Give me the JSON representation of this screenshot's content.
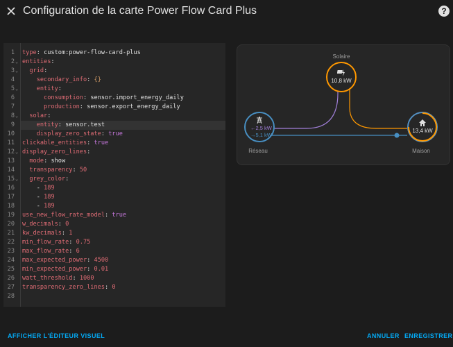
{
  "dialog": {
    "title": "Configuration de la carte Power Flow Card Plus",
    "close_icon": "close-icon",
    "help_icon": "help-circle-icon"
  },
  "editor": {
    "lines": [
      {
        "n": "1",
        "fold": false,
        "indent": "",
        "key": "type",
        "value": "custom:power-flow-card-plus",
        "vtype": "s"
      },
      {
        "n": "2",
        "fold": true,
        "indent": "",
        "key": "entities",
        "value": "",
        "vtype": ""
      },
      {
        "n": "3",
        "fold": true,
        "indent": "  ",
        "key": "grid",
        "value": "",
        "vtype": ""
      },
      {
        "n": "4",
        "fold": false,
        "indent": "    ",
        "key": "secondary_info",
        "value": "{}",
        "vtype": "o"
      },
      {
        "n": "5",
        "fold": true,
        "indent": "    ",
        "key": "entity",
        "value": "",
        "vtype": ""
      },
      {
        "n": "6",
        "fold": false,
        "indent": "      ",
        "key": "consumption",
        "value": "sensor.import_energy_daily",
        "vtype": "s"
      },
      {
        "n": "7",
        "fold": false,
        "indent": "      ",
        "key": "production",
        "value": "sensor.export_energy_daily",
        "vtype": "s"
      },
      {
        "n": "8",
        "fold": true,
        "indent": "  ",
        "key": "solar",
        "value": "",
        "vtype": ""
      },
      {
        "n": "9",
        "fold": false,
        "indent": "    ",
        "key": "entity",
        "value": "sensor.test",
        "vtype": "s"
      },
      {
        "n": "10",
        "fold": false,
        "indent": "    ",
        "key": "display_zero_state",
        "value": "true",
        "vtype": "b"
      },
      {
        "n": "11",
        "fold": false,
        "indent": "",
        "key": "clickable_entities",
        "value": "true",
        "vtype": "b"
      },
      {
        "n": "12",
        "fold": true,
        "indent": "",
        "key": "display_zero_lines",
        "value": "",
        "vtype": ""
      },
      {
        "n": "13",
        "fold": false,
        "indent": "  ",
        "key": "mode",
        "value": "show",
        "vtype": "s"
      },
      {
        "n": "14",
        "fold": false,
        "indent": "  ",
        "key": "transparency",
        "value": "50",
        "vtype": "n"
      },
      {
        "n": "15",
        "fold": true,
        "indent": "  ",
        "key": "grey_color",
        "value": "",
        "vtype": ""
      },
      {
        "n": "16",
        "fold": false,
        "indent": "    ",
        "key": "- ",
        "value": "189",
        "vtype": "d"
      },
      {
        "n": "17",
        "fold": false,
        "indent": "    ",
        "key": "- ",
        "value": "189",
        "vtype": "d"
      },
      {
        "n": "18",
        "fold": false,
        "indent": "    ",
        "key": "- ",
        "value": "189",
        "vtype": "d"
      },
      {
        "n": "19",
        "fold": false,
        "indent": "",
        "key": "use_new_flow_rate_model",
        "value": "true",
        "vtype": "b"
      },
      {
        "n": "20",
        "fold": false,
        "indent": "",
        "key": "w_decimals",
        "value": "0",
        "vtype": "n"
      },
      {
        "n": "21",
        "fold": false,
        "indent": "",
        "key": "kw_decimals",
        "value": "1",
        "vtype": "n"
      },
      {
        "n": "22",
        "fold": false,
        "indent": "",
        "key": "min_flow_rate",
        "value": "0.75",
        "vtype": "n"
      },
      {
        "n": "23",
        "fold": false,
        "indent": "",
        "key": "max_flow_rate",
        "value": "6",
        "vtype": "n"
      },
      {
        "n": "24",
        "fold": false,
        "indent": "",
        "key": "max_expected_power",
        "value": "4500",
        "vtype": "n"
      },
      {
        "n": "25",
        "fold": false,
        "indent": "",
        "key": "min_expected_power",
        "value": "0.01",
        "vtype": "n"
      },
      {
        "n": "26",
        "fold": false,
        "indent": "",
        "key": "watt_threshold",
        "value": "1000",
        "vtype": "n"
      },
      {
        "n": "27",
        "fold": false,
        "indent": "",
        "key": "transparency_zero_lines",
        "value": "0",
        "vtype": "n"
      },
      {
        "n": "28",
        "fold": false,
        "indent": "",
        "key": "",
        "value": "",
        "vtype": ""
      }
    ],
    "active_line": "9"
  },
  "preview": {
    "solar": {
      "label": "Solaire",
      "value": "10,8 kW",
      "icon": "solar-power-icon",
      "color": "#ff9800"
    },
    "grid": {
      "label": "Réseau",
      "import": "←2,5 kW",
      "export": "→5,1 kW",
      "icon": "transmission-tower-icon",
      "color": "#488fc2",
      "import_color": "#a280db"
    },
    "home": {
      "label": "Maison",
      "value": "13,4 kW",
      "icon": "home-icon",
      "color": "#5490c2"
    }
  },
  "footer": {
    "visual_editor": "AFFICHER L'ÉDITEUR VISUEL",
    "cancel": "ANNULER",
    "save": "ENREGISTRER"
  }
}
